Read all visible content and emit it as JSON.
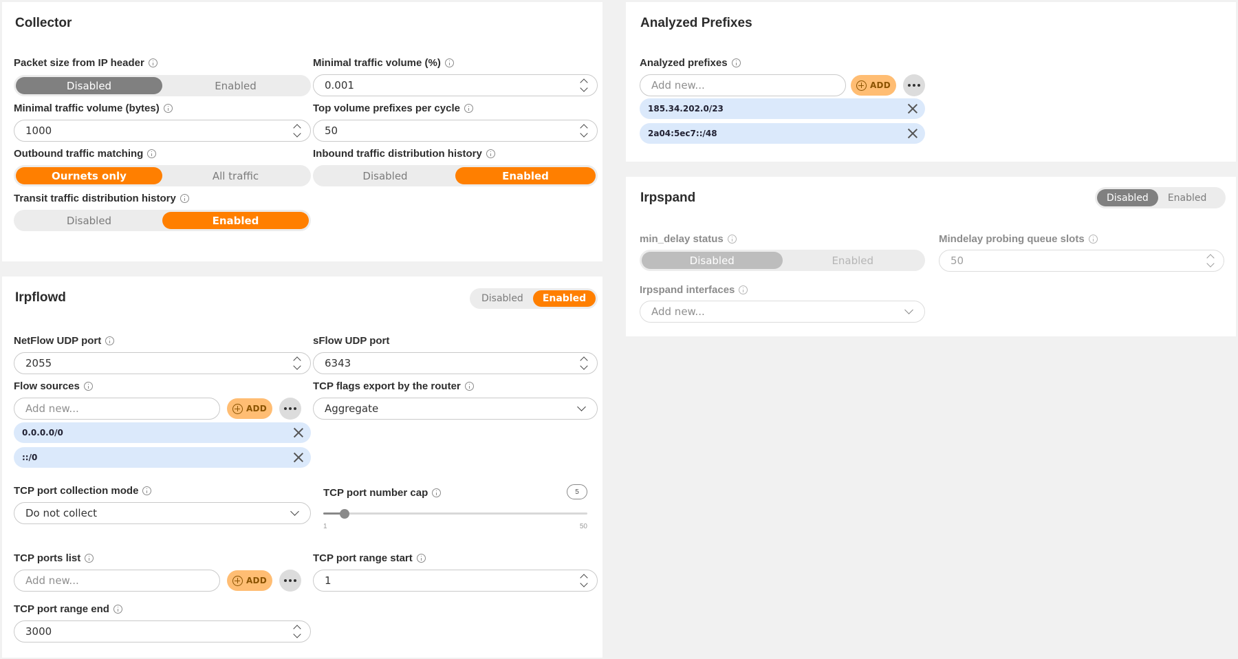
{
  "collector": {
    "title": "Collector",
    "packet_size": {
      "label": "Packet size from IP header",
      "options": [
        "Disabled",
        "Enabled"
      ],
      "selected": "Disabled"
    },
    "min_volume_pct": {
      "label": "Minimal traffic volume (%)",
      "value": "0.001"
    },
    "min_volume_bytes": {
      "label": "Minimal traffic volume (bytes)",
      "value": "1000"
    },
    "top_prefixes": {
      "label": "Top volume prefixes per cycle",
      "value": "50"
    },
    "outbound_matching": {
      "label": "Outbound traffic matching",
      "options": [
        "Ournets only",
        "All traffic"
      ],
      "selected": "Ournets only"
    },
    "inbound_history": {
      "label": "Inbound traffic distribution history",
      "options": [
        "Disabled",
        "Enabled"
      ],
      "selected": "Enabled"
    },
    "transit_history": {
      "label": "Transit traffic distribution history",
      "options": [
        "Disabled",
        "Enabled"
      ],
      "selected": "Enabled"
    }
  },
  "irpflowd": {
    "title": "Irpflowd",
    "toggle": {
      "options": [
        "Disabled",
        "Enabled"
      ],
      "selected": "Enabled"
    },
    "netflow_port": {
      "label": "NetFlow UDP port",
      "value": "2055"
    },
    "sflow_port": {
      "label": "sFlow UDP port",
      "value": "6343"
    },
    "flow_sources": {
      "label": "Flow sources",
      "placeholder": "Add new...",
      "add_label": "ADD",
      "items": [
        "0.0.0.0/0",
        "::/0"
      ]
    },
    "tcp_flags": {
      "label": "TCP flags export by the router",
      "value": "Aggregate"
    },
    "tcp_collection": {
      "label": "TCP port collection mode",
      "value": "Do not collect"
    },
    "tcp_cap": {
      "label": "TCP port number cap",
      "value": "5",
      "min": "1",
      "max": "50"
    },
    "tcp_ports_list": {
      "label": "TCP ports list",
      "placeholder": "Add new...",
      "add_label": "ADD"
    },
    "tcp_range_start": {
      "label": "TCP port range start",
      "value": "1"
    },
    "tcp_range_end": {
      "label": "TCP port range end",
      "value": "3000"
    }
  },
  "analyzed": {
    "title": "Analyzed Prefixes",
    "prefixes": {
      "label": "Analyzed prefixes",
      "placeholder": "Add new...",
      "add_label": "ADD",
      "items": [
        "185.34.202.0/23",
        "2a04:5ec7::/48"
      ]
    }
  },
  "irpspand": {
    "title": "Irpspand",
    "toggle": {
      "options": [
        "Disabled",
        "Enabled"
      ],
      "selected": "Disabled"
    },
    "min_delay": {
      "label": "min_delay status",
      "options": [
        "Disabled",
        "Enabled"
      ],
      "selected": "Disabled"
    },
    "queue_slots": {
      "label": "Mindelay probing queue slots",
      "value": "50"
    },
    "interfaces": {
      "label": "Irpspand interfaces",
      "placeholder": "Add new..."
    }
  },
  "colors": {
    "accent": "#ff7f00",
    "tag_bg": "#dbe9fb",
    "add_bg": "#ffbd73"
  }
}
